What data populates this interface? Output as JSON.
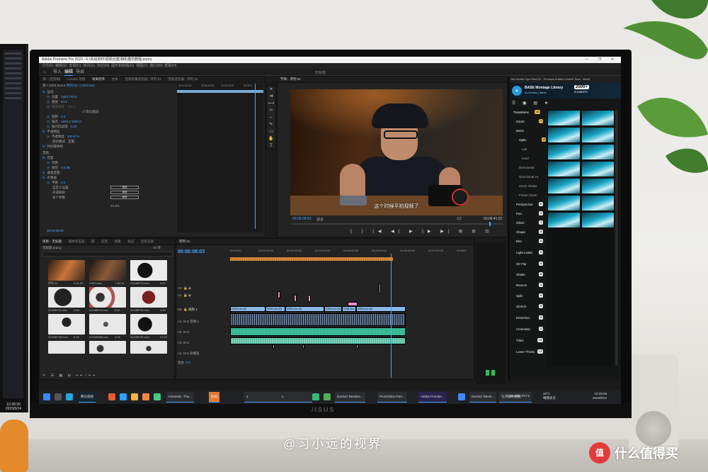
{
  "app": {
    "title": "Adobe Premiere Pro 2023 - E:\\实战资料\\视频合集\\相机模仿教程.prproj",
    "window_controls": "— ❐ ✕",
    "doc_title": "无标题"
  },
  "menu": [
    "文件(F)",
    "编辑(E)",
    "剪辑(C)",
    "序列(S)",
    "标记(M)",
    "图形和标题(G)",
    "视图(V)",
    "窗口(W)",
    "帮助(H)"
  ],
  "workspace": {
    "home": "⌂",
    "import": "导入",
    "edit": "编辑",
    "export": "导出"
  },
  "effect_controls": {
    "tabs": [
      "源：(无剪辑)",
      "Lumetri 范围",
      "效果控件",
      "文本",
      "音频剪辑混合器：序列 01",
      "音轨混合器：序列 01"
    ],
    "source": "源 • C003.mov",
    "sequence": "序列 01 • C003.mov",
    "rows": [
      {
        "label": "运动",
        "value": ""
      },
      {
        "label": "位置",
        "value": "1653   705.0"
      },
      {
        "label": "缩放",
        "value": "63.0"
      },
      {
        "label": "缩放宽度",
        "value": "100.0"
      },
      {
        "label": "旋转",
        "value": "0.0"
      },
      {
        "label": "锚点",
        "value": "1920.0   1080.0"
      },
      {
        "label": "防闪烁滤镜",
        "value": "0.00"
      },
      {
        "label": "不透明度",
        "value": ""
      },
      {
        "label": "不透明度",
        "value": "100.0 %"
      },
      {
        "label": "混合模式",
        "value": "正常"
      },
      {
        "label": "时间重映射",
        "value": ""
      },
      {
        "label": "音频",
        "value": ""
      },
      {
        "label": "音量",
        "value": ""
      },
      {
        "label": "旁路",
        "value": ""
      },
      {
        "label": "级别",
        "value": "0.0 dB"
      },
      {
        "label": "通道音量",
        "value": ""
      },
      {
        "label": "声像器",
        "value": ""
      },
      {
        "label": "平衡",
        "value": "0.0"
      }
    ],
    "percent": "24.3%",
    "uniform_scale": "等比缩放",
    "buttons": [
      "编辑",
      "编辑",
      "编辑"
    ],
    "rows2": [
      "自定义设置",
      "声道映射",
      "多个参数"
    ],
    "tc": "00:06:08:03"
  },
  "ec_ruler": [
    "00:04:00:00",
    "00:04:32:00",
    "00:05:28:00",
    "00:06:0"
  ],
  "program": {
    "tab": "节目：序列 01",
    "subtitle": "这个时候平拍视频了",
    "timecode": "00:06:08:03",
    "fit": "适合",
    "duration": "00:06:41:22",
    "quality": "1/2",
    "transport": "{  }  |◀  ◀|  ▶  |▶  ▶|  ⊞  ⊟  ⊡"
  },
  "project": {
    "tabs": [
      "项目：无标题",
      "媒体浏览器",
      "库",
      "信息",
      "效果",
      "标记",
      "历史记录"
    ],
    "path": "无标题.prproj",
    "count": "15 项",
    "items": [
      {
        "name": "序列 01",
        "dur": "6:41:22"
      },
      {
        "name": "C000.mov",
        "dur": "7:39:14"
      },
      {
        "name": "2224807S.mov",
        "dur": "4:07"
      },
      {
        "name": "2224807U.mov",
        "dur": "3:48"
      },
      {
        "name": "2224807A.mov",
        "dur": "6:00"
      },
      {
        "name": "2224807B.mov",
        "dur": "4:00"
      },
      {
        "name": "2224807W.mov",
        "dur": "5:18"
      },
      {
        "name": "2224808B.mov",
        "dur": "4:49"
      },
      {
        "name": "2224807E.mov",
        "dur": "47:00"
      },
      {
        "name": "",
        "dur": ""
      },
      {
        "name": "",
        "dur": ""
      },
      {
        "name": "",
        "dur": ""
      }
    ]
  },
  "timeline": {
    "tab": "序列 01",
    "timecode": "00:06:08:03",
    "ruler": [
      "00:00:00",
      "00:01:00:00",
      "00:02:00:00",
      "00:03:00:00",
      "00:04:00:00",
      "00:05:00:00",
      "00:06:00:00",
      "00:07:00:00",
      "00:08:0"
    ],
    "tracks": [
      "V3",
      "V2",
      "V1",
      "A1",
      "A2",
      "A3",
      "A4"
    ],
    "track_names": {
      "v1": "视频 1",
      "a1": "音频 1",
      "mix": "混合",
      "mix_val": "0.0",
      "a_label": "旁路轨"
    },
    "v1_clips": [
      "C003.mov [V]",
      "C002.mov [V]",
      "C003.mov [V]",
      "C002.mov [V]",
      "C006.mov [V]",
      "C003.mov [V]"
    ]
  },
  "base": {
    "tabs": [
      "Ber Kinetic Type Pack EL",
      "Premium Builder Content Tools",
      "Montt"
    ],
    "title": "BASE Montage Library",
    "subtitle": "by Envato | ideas",
    "badge": "2500+",
    "badge_sub": "ELEMENTS",
    "categories": [
      {
        "name": "Transitions",
        "count": "150"
      },
      {
        "name": "Zoom",
        "count": "74"
      },
      {
        "name": "Basic",
        "count": ""
      },
      {
        "name": "Optic",
        "count": "18"
      },
      {
        "name": "Lite",
        "count": ""
      },
      {
        "name": "Hard",
        "count": ""
      },
      {
        "name": "Directional",
        "count": ""
      },
      {
        "name": "Directional HI",
        "count": ""
      },
      {
        "name": "Zoom Shake",
        "count": ""
      },
      {
        "name": "Power Zoom",
        "count": ""
      },
      {
        "name": "Perspective",
        "count": "80"
      },
      {
        "name": "Pan",
        "count": "52"
      },
      {
        "name": "Glitch",
        "count": "70"
      },
      {
        "name": "Shape",
        "count": "25"
      },
      {
        "name": "Blur",
        "count": "34"
      },
      {
        "name": "Light Leaks",
        "count": "34"
      },
      {
        "name": "3D Flip",
        "count": "36"
      },
      {
        "name": "Shake",
        "count": "48"
      },
      {
        "name": "Bounce",
        "count": "24"
      },
      {
        "name": "Split",
        "count": "30"
      },
      {
        "name": "Stretch",
        "count": "29"
      },
      {
        "name": "Distortion",
        "count": "42"
      },
      {
        "name": "Cinematic",
        "count": "42"
      },
      {
        "name": "Titles",
        "count": "200"
      },
      {
        "name": "Lower Thirds",
        "count": "100"
      }
    ]
  },
  "taskbar": {
    "apps": [
      "腾讯视频",
      "Immortal - Tho...",
      "会员",
      "1",
      "1",
      "DaVinci Resolve...",
      "PANO0001-Pan...",
      "Adobe Premier...",
      "DaVinci Resol...",
      "写小说的视频...",
      "Color Elite Pro 5"
    ],
    "weather_temp": "30°C",
    "weather_text": "晴朗多云",
    "time": "10:28:39",
    "date": "2023/5/24"
  },
  "left_monitor_clock": {
    "time": "10:28:39",
    "date": "2023/5/24"
  },
  "hardware": {
    "brand": "/ISUS"
  },
  "watermark": "@习小远的视界",
  "smzdm": "什么值得买",
  "smzdm_logo": "值"
}
